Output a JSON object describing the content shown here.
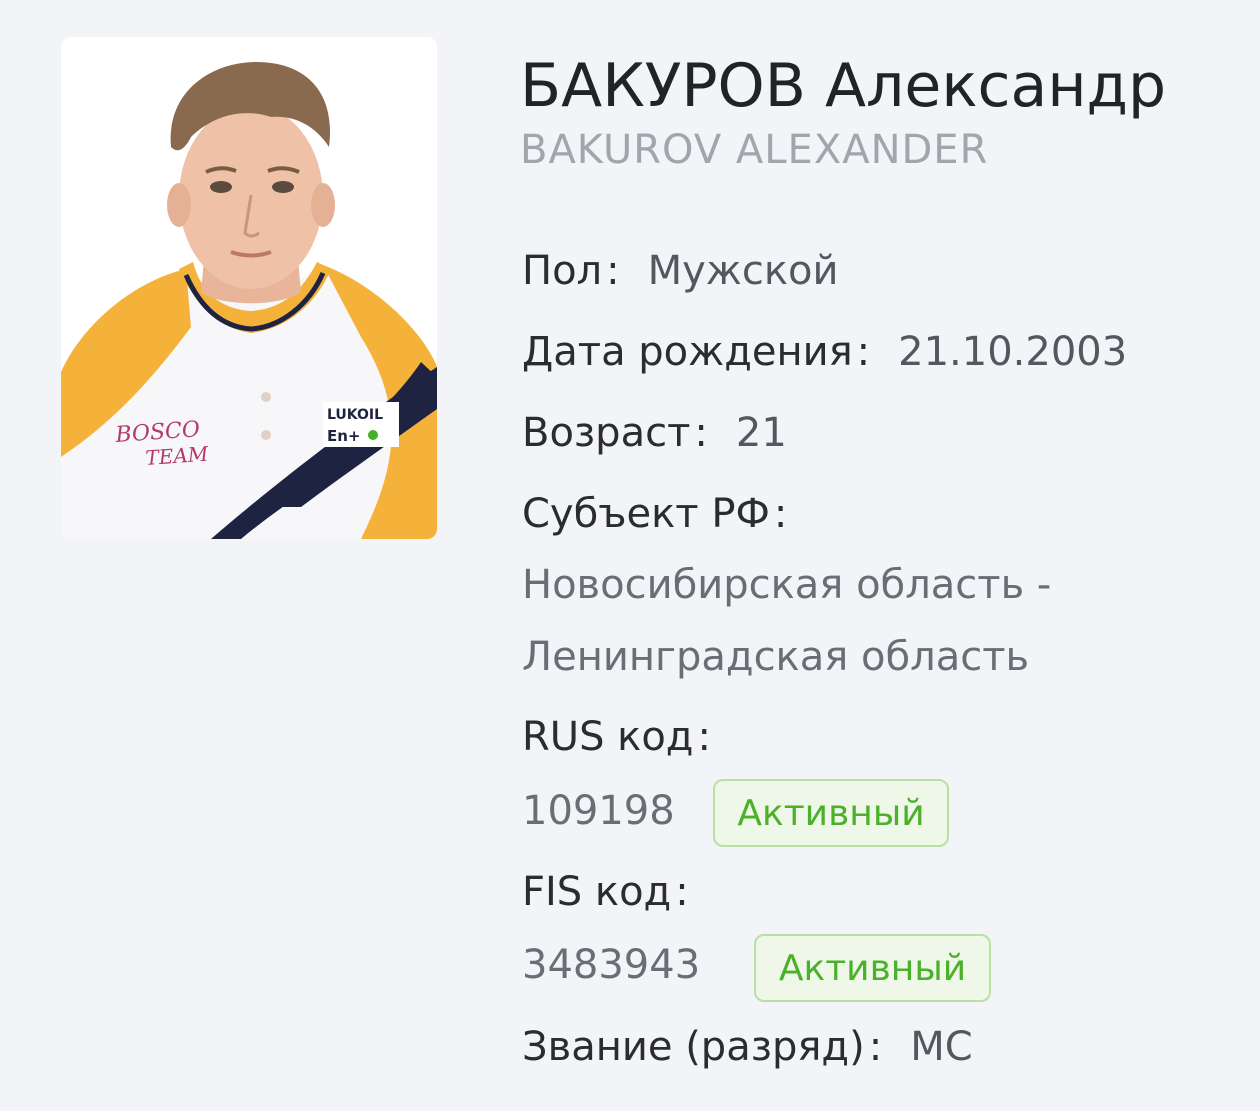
{
  "athlete": {
    "name_ru": "БАКУРОВ Александр",
    "name_en": "BAKUROV ALEXANDER",
    "photo": {
      "shirt_text_1": "BOSCO",
      "shirt_text_2": "TEAM",
      "sponsor_1": "LUKOIL",
      "sponsor_2": "En+"
    }
  },
  "fields": {
    "gender_label": "Пол",
    "gender_value": "Мужской",
    "birth_label": "Дата рождения",
    "birth_value": "21.10.2003",
    "age_label": "Возраст",
    "age_value": "21",
    "region_label": "Субъект РФ",
    "region_line1": "Новосибирская область -",
    "region_line2": "Ленинградская область",
    "rus_label": "RUS код",
    "rus_value": "109198",
    "rus_status": "Активный",
    "fis_label": "FIS код",
    "fis_value": "3483943",
    "fis_status": "Активный",
    "rank_label": "Звание (разряд)",
    "rank_value": "МС"
  },
  "colors": {
    "background": "#f3f4f8",
    "status_green": "#4bb02a",
    "status_border": "#b8dfa4"
  }
}
